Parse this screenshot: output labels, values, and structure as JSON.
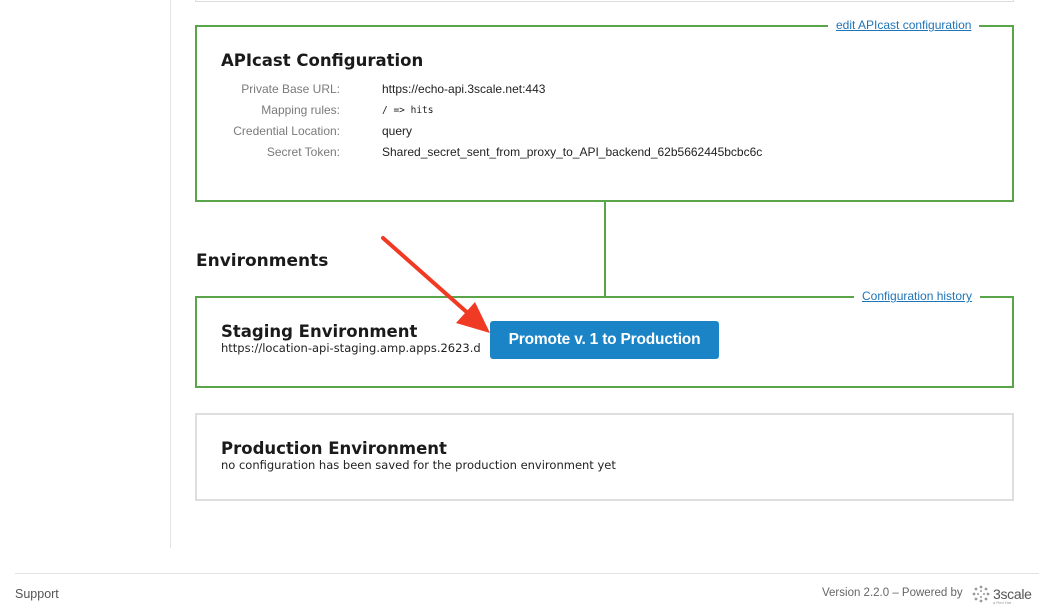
{
  "apicast": {
    "edit_link": "edit APIcast configuration",
    "title": "APIcast Configuration",
    "rows": [
      {
        "label": "Private Base URL:",
        "value": "https://echo-api.3scale.net:443"
      },
      {
        "label": "Mapping rules:",
        "value": "/ => hits"
      },
      {
        "label": "Credential Location:",
        "value": "query"
      },
      {
        "label": "Secret Token:",
        "value": "Shared_secret_sent_from_proxy_to_API_backend_62b5662445bcbc6c"
      }
    ]
  },
  "environments": {
    "heading": "Environments",
    "history_link": "Configuration history",
    "staging": {
      "title": "Staging Environment",
      "url": "https://location-api-staging.amp.apps.2623.d",
      "promote_label": "Promote v. 1 to Production"
    },
    "production": {
      "title": "Production Environment",
      "note": "no configuration has been saved for the production environment yet"
    }
  },
  "footer": {
    "support": "Support",
    "version": "Version 2.2.0 – Powered by",
    "brand": "3scale",
    "brand_subtext": "a Red Hat"
  },
  "colors": {
    "green_border": "#5aa54a",
    "button_blue": "#1b84c7",
    "link_blue": "#1f75b8",
    "arrow_red": "#f03a24"
  },
  "icons": [
    "arrow-annotation-icon",
    "3scale-logo-icon"
  ]
}
